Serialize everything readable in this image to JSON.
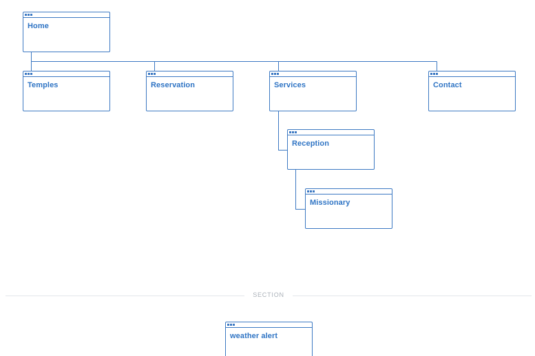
{
  "colors": {
    "accent": "#3b78c2",
    "text": "#2f74c4",
    "divider": "#e3e6ea",
    "section_label": "#aab1b8"
  },
  "nodes": {
    "home": "Home",
    "temples": "Temples",
    "reservation": "Reservation",
    "services": "Services",
    "contact": "Contact",
    "reception": "Reception",
    "missionary": "Missionary",
    "weather_alert": "weather alert"
  },
  "section": {
    "label": "SECTION"
  }
}
